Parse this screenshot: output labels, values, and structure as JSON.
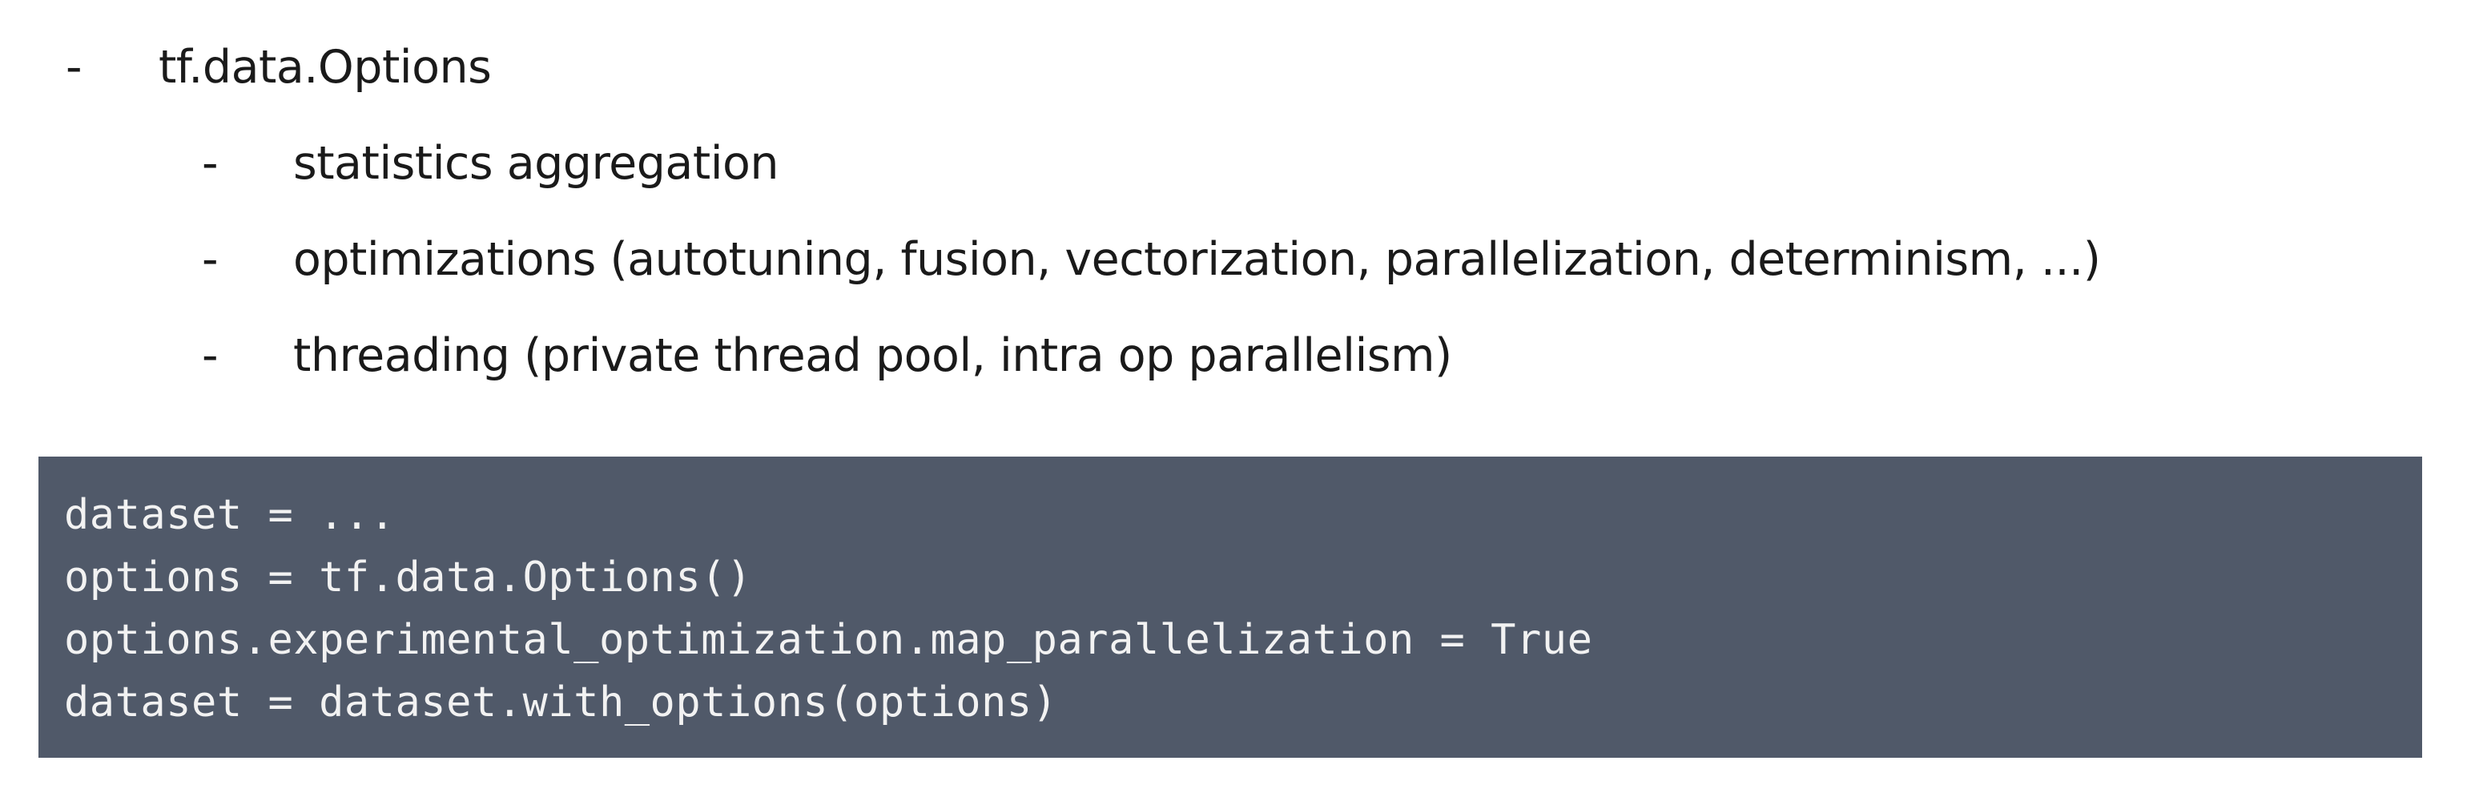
{
  "bullets": {
    "main": {
      "marker": "-",
      "text": "tf.data.Options"
    },
    "sub": [
      {
        "marker": "-",
        "text": "statistics aggregation"
      },
      {
        "marker": "-",
        "text": "optimizations (autotuning, fusion, vectorization, parallelization, determinism, ...)"
      },
      {
        "marker": "-",
        "text": "threading (private thread pool, intra op parallelism)"
      }
    ]
  },
  "code": {
    "lines": [
      "dataset = ...",
      "options = tf.data.Options()",
      "options.experimental_optimization.map_parallelization = True",
      "dataset = dataset.with_options(options)"
    ],
    "background": "#505969",
    "text_color": "#f2f2f2"
  }
}
